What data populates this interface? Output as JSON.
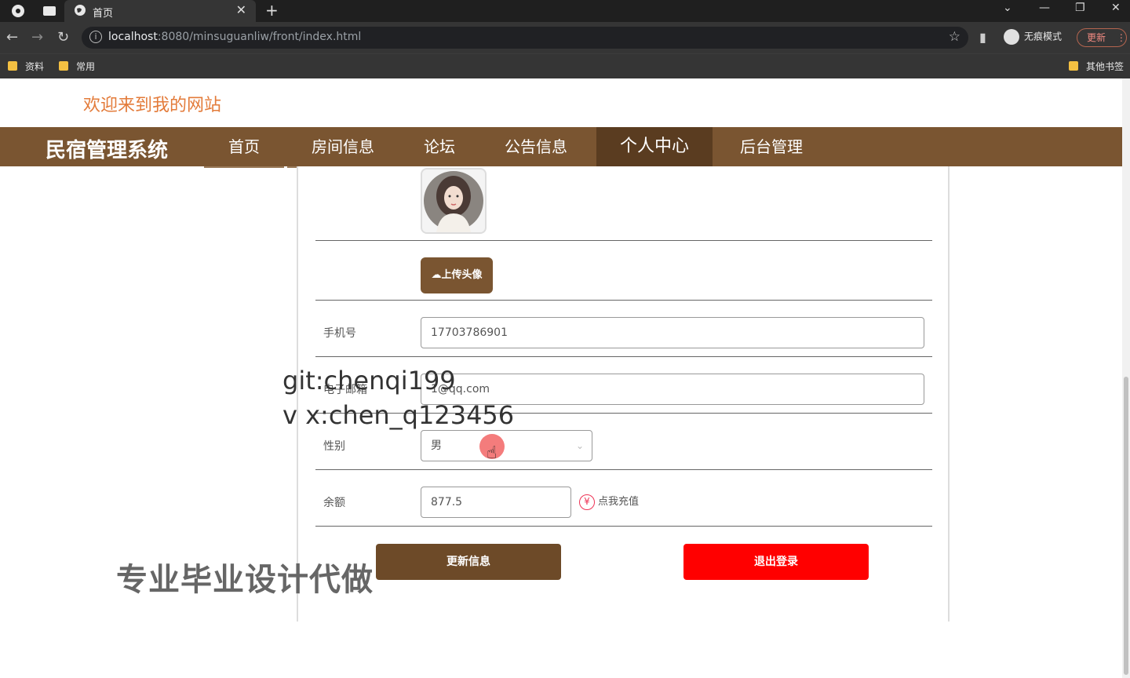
{
  "browser": {
    "tab_title": "首页",
    "url_host": "localhost",
    "url_rest": ":8080/minsuguanliw/front/index.html",
    "incognito_label": "无痕模式",
    "update_label": "更新",
    "bookmarks": [
      "资料",
      "常用"
    ],
    "other_bookmarks": "其他书签"
  },
  "site": {
    "welcome": "欢迎来到我的网站",
    "brand": "民宿管理系统",
    "nav": [
      "首页",
      "房间信息",
      "论坛",
      "公告信息",
      "个人中心",
      "后台管理"
    ],
    "active_nav": "个人中心"
  },
  "profile": {
    "upload_label": "上传头像",
    "phone_label": "手机号",
    "phone_value": "17703786901",
    "email_label": "电子邮箱",
    "email_value": "1@qq.com",
    "gender_label": "性别",
    "gender_value": "男",
    "balance_label": "余额",
    "balance_value": "877.5",
    "recharge_label": "点我充值",
    "update_button": "更新信息",
    "logout_button": "退出登录"
  },
  "watermarks": {
    "line1": "git:chenqi199",
    "line2": "v x:chen_q123456",
    "line3": "专业毕业设计代做"
  },
  "colors": {
    "nav_bg": "#7a5531",
    "welcome": "#e37b3a",
    "logout": "#ff0000"
  }
}
